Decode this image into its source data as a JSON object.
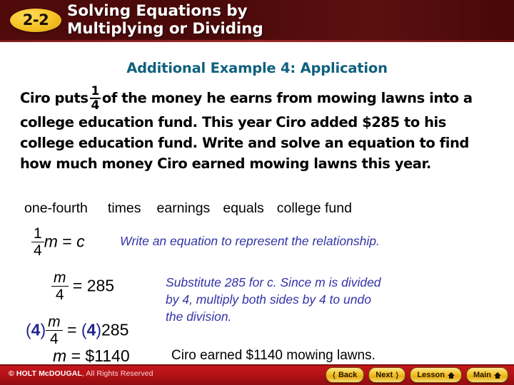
{
  "header": {
    "lesson_number": "2-2",
    "title_line1": "Solving Equations by",
    "title_line2": "Multiplying or Dividing",
    "bg_color": "#4a0909",
    "badge_color": "#f8c72c"
  },
  "subtitle": {
    "text": "Additional Example 4: Application",
    "color": "#10617f"
  },
  "problem": {
    "part1": "Ciro puts",
    "fraction_numerator": "1",
    "fraction_denominator": "4",
    "part2": "of the money he earns from mowing lawns into a college education fund. This year Ciro added $285 to his college education fund. Write and solve an equation to find how much money Ciro earned mowing lawns this year."
  },
  "word_equation": {
    "one_fourth": "one-fourth",
    "times": "times",
    "earnings": "earnings",
    "equals": "equals",
    "college_fund": "college fund"
  },
  "steps": {
    "step1": {
      "numerator": "1",
      "denominator": "4",
      "variable": "m",
      "equals": "=",
      "result": "c",
      "annotation": "Write an equation to represent the relationship."
    },
    "step2": {
      "numerator": "m",
      "denominator": "4",
      "equals": "=",
      "result": "285",
      "annotation_line1": "Substitute 285 for c. Since m is divided",
      "annotation_line2": "by 4, multiply both sides by 4 to undo",
      "annotation_line3": "the division."
    },
    "step3": {
      "left_paren": "(",
      "left_multiplier": "4",
      "right_paren": ")",
      "numerator": "m",
      "denominator": "4",
      "equals": "=",
      "right_multiplier": "4",
      "result": "285",
      "multiplier_color": "#22228e"
    },
    "step4": {
      "variable": "m",
      "equals": "=",
      "result": "$1140",
      "annotation": "Ciro earned $1140 mowing lawns."
    }
  },
  "footer": {
    "copyright_brand": "© HOLT McDOUGAL",
    "copyright_rest": ", All Rights Reserved",
    "bg_color": "#b31217",
    "buttons": [
      {
        "label": "Back",
        "icon": "chevron-left-icon"
      },
      {
        "label": "Next",
        "icon": "chevron-right-icon"
      },
      {
        "label": "Lesson",
        "icon": "home-icon"
      },
      {
        "label": "Main",
        "icon": "home-icon"
      }
    ]
  }
}
